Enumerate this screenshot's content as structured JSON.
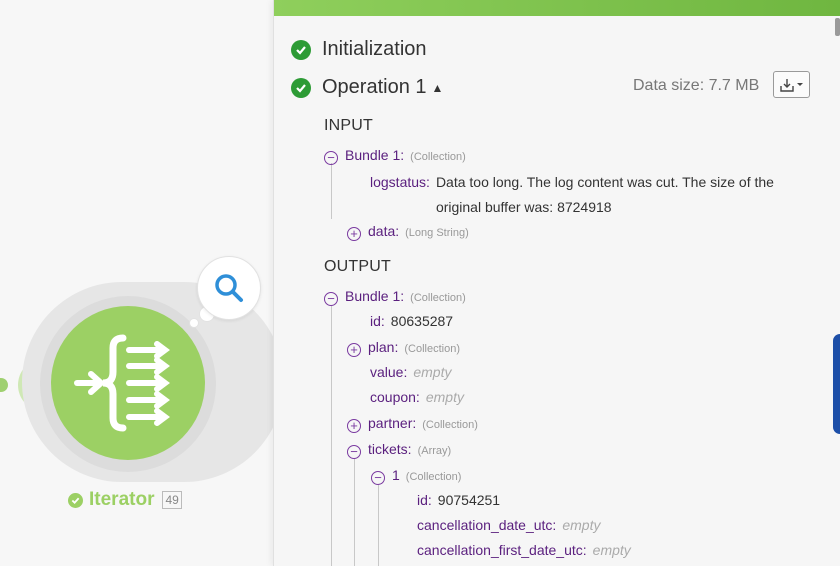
{
  "canvas": {
    "module": {
      "name": "Iterator",
      "count": "49",
      "icon": "iterator-icon",
      "inspect_icon": "magnifier-icon"
    },
    "colors": {
      "module_green": "#9cd064",
      "success_green": "#2d9b35",
      "key_purple": "#5a1f7e"
    }
  },
  "panel": {
    "initialization_label": "Initialization",
    "operation_label": "Operation 1",
    "data_size_label": "Data size: 7.7 MB",
    "download_icon": "download-icon",
    "input": {
      "title": "INPUT",
      "bundle": {
        "key": "Bundle 1:",
        "type": "(Collection)"
      },
      "logstatus": {
        "key": "logstatus:",
        "value": "Data too long. The log content was cut. The size of the original buffer was: 8724918"
      },
      "data": {
        "key": "data:",
        "type": "(Long String)"
      }
    },
    "output": {
      "title": "OUTPUT",
      "bundle": {
        "key": "Bundle 1:",
        "type": "(Collection)"
      },
      "id": {
        "key": "id:",
        "value": "80635287"
      },
      "plan": {
        "key": "plan:",
        "type": "(Collection)"
      },
      "value": {
        "key": "value:",
        "value": "empty"
      },
      "coupon": {
        "key": "coupon:",
        "value": "empty"
      },
      "partner": {
        "key": "partner:",
        "type": "(Collection)"
      },
      "tickets": {
        "key": "tickets:",
        "type": "(Array)"
      },
      "ticket1": {
        "key": "1",
        "type": "(Collection)"
      },
      "ticket_id": {
        "key": "id:",
        "value": "90754251"
      },
      "cancellation_date_utc": {
        "key": "cancellation_date_utc:",
        "value": "empty"
      },
      "cancellation_first_date_utc": {
        "key": "cancellation_first_date_utc:",
        "value": "empty"
      }
    }
  }
}
